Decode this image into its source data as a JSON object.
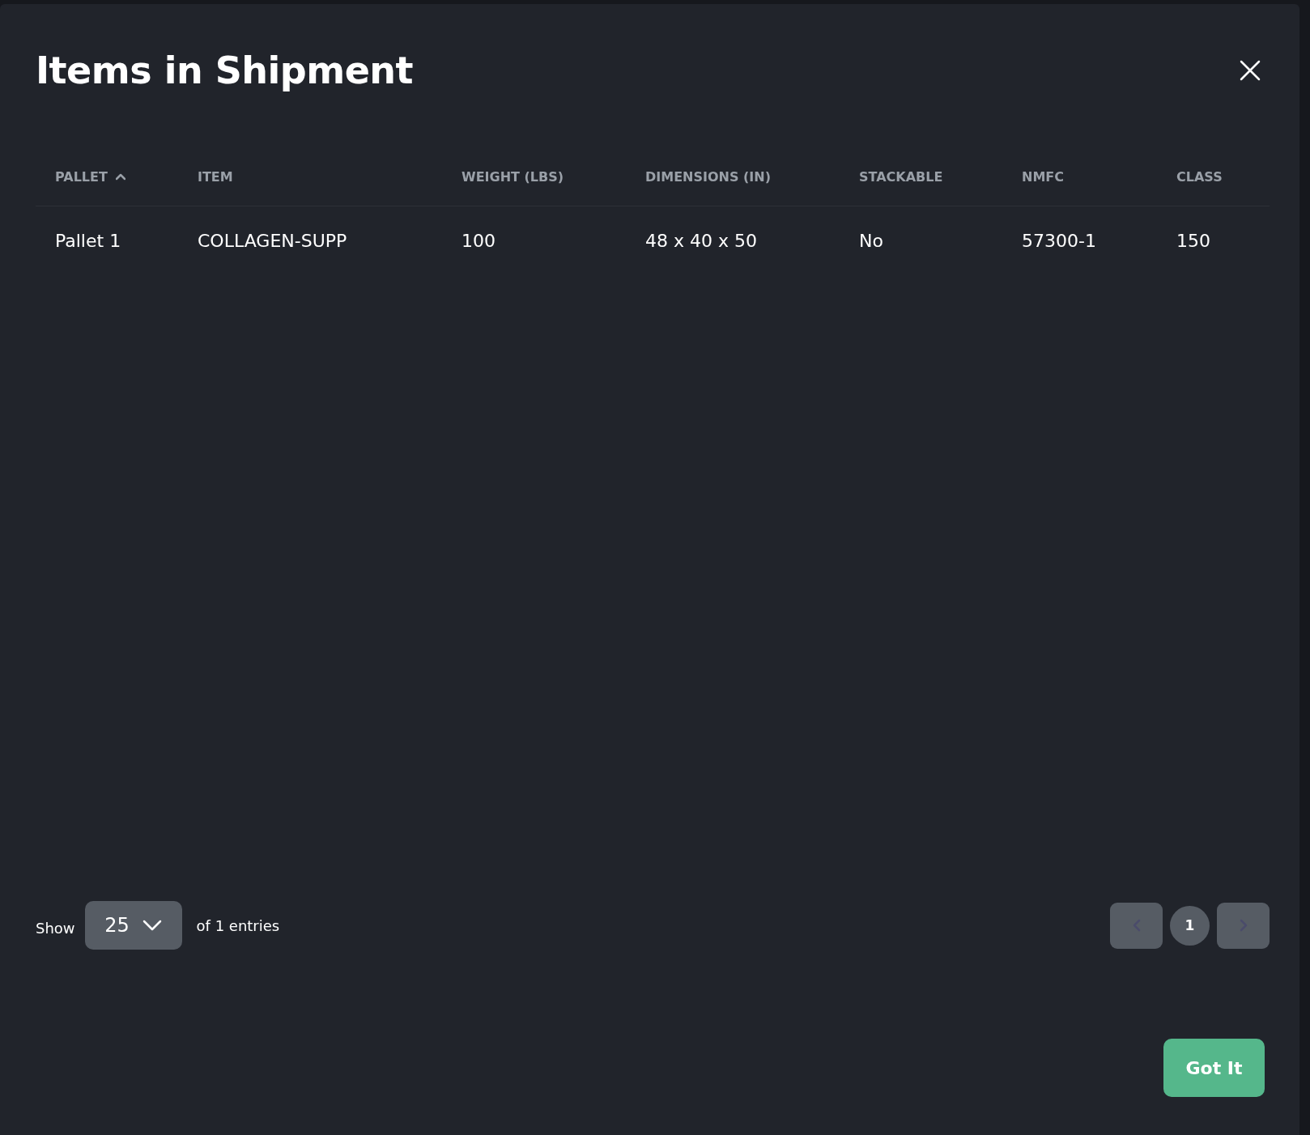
{
  "modal": {
    "title": "Items in Shipment"
  },
  "table": {
    "columns": [
      {
        "label": "PALLET",
        "sorted_ascending": true
      },
      {
        "label": "ITEM",
        "sorted_ascending": false
      },
      {
        "label": "WEIGHT (LBS)",
        "sorted_ascending": false
      },
      {
        "label": "DIMENSIONS (IN)",
        "sorted_ascending": false
      },
      {
        "label": "STACKABLE",
        "sorted_ascending": false
      },
      {
        "label": "NMFC",
        "sorted_ascending": false
      },
      {
        "label": "CLASS",
        "sorted_ascending": false
      }
    ],
    "rows": [
      [
        "Pallet 1",
        "COLLAGEN-SUPP",
        "100",
        "48 x 40 x 50",
        "No",
        "57300-1",
        "150"
      ]
    ]
  },
  "footer": {
    "show_label": "Show",
    "page_size": "25",
    "entries_text": "of 1 entries",
    "pagination": {
      "previous_disabled": true,
      "next_disabled": true,
      "pages": [
        {
          "label": "1",
          "selected": true
        }
      ]
    }
  },
  "buttons": [
    {
      "label": "Got It"
    }
  ]
}
